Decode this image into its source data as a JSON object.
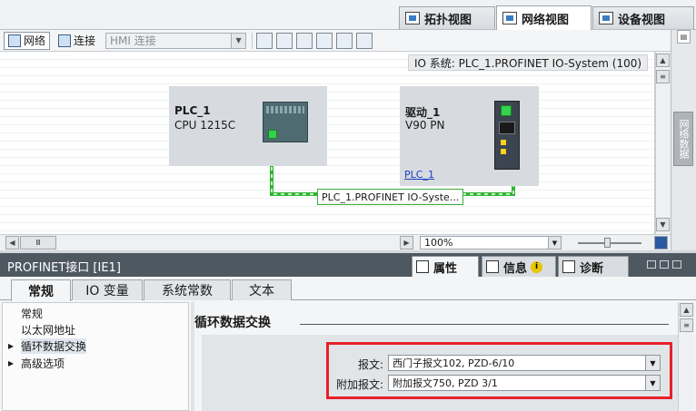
{
  "view_tabs": {
    "topology": "拓扑视图",
    "network": "网络视图",
    "device": "设备视图"
  },
  "toolbar": {
    "network_label": "网络",
    "connect_label": "连接",
    "connection_type": "HMI 连接"
  },
  "canvas": {
    "subnet_label": "IO 系统: PLC_1.PROFINET IO-System (100)",
    "plc": {
      "name": "PLC_1",
      "type": "CPU 1215C"
    },
    "drive": {
      "name": "驱动_1",
      "type": "V90 PN",
      "link": "PLC_1"
    },
    "network_label": "PLC_1.PROFINET IO-Syste..."
  },
  "side_tab_label": "网络数据",
  "zoom": {
    "value": "100%"
  },
  "inspector": {
    "title": "PROFINET接口 [IE1]",
    "tabs": {
      "properties": "属性",
      "info": "信息",
      "diagnostics": "诊断"
    },
    "subtabs": [
      "常规",
      "IO 变量",
      "系统常数",
      "文本"
    ],
    "nav": [
      "常规",
      "以太网地址",
      "循环数据交换",
      "高级选项"
    ],
    "section_title": "循环数据交换",
    "fields": {
      "telegram_label": "报文:",
      "telegram_value": "西门子报文102, PZD-6/10",
      "extra_label": "附加报文:",
      "extra_value": "附加报文750, PZD 3/1"
    }
  },
  "colors": {
    "highlight": "#e8202a",
    "profinet_line": "#2fb52f",
    "inspector_header": "#4e5861"
  }
}
